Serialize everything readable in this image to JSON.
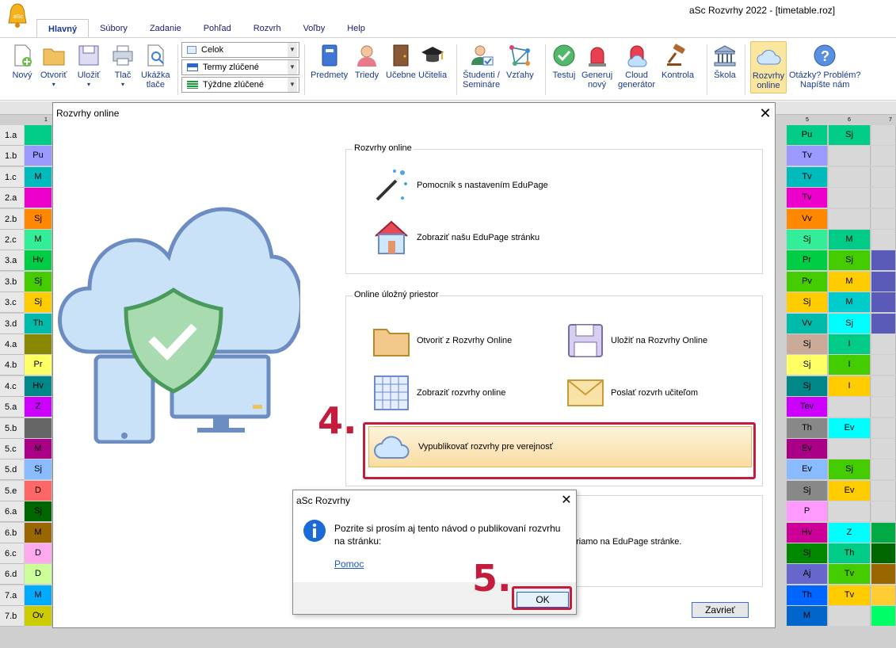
{
  "app": {
    "title": "aSc Rozvrhy 2022  - [timetable.roz]"
  },
  "tabs": [
    "Hlavný",
    "Súbory",
    "Zadanie",
    "Pohľad",
    "Rozvrh",
    "Voľby",
    "Help"
  ],
  "ribbon": {
    "novy": "Nový",
    "otvorit": "Otvoriť",
    "ulozit": "Uložiť",
    "tlac": "Tlač",
    "ukazka1": "Ukážka",
    "ukazka2": "tlače",
    "combo1": "Celok",
    "combo2": "Termy zlúčené",
    "combo3": "Týždne zlúčené",
    "predmety": "Predmety",
    "triedy": "Triedy",
    "ucebne": "Učebne",
    "ucitelia": "Učitelia",
    "studenti1": "Študenti /",
    "studenti2": "Semináre",
    "vztahy": "Vzťahy",
    "testuj": "Testuj",
    "generuj1": "Generuj",
    "generuj2": "nový",
    "cloud1": "Cloud",
    "cloud2": "generátor",
    "kontrola": "Kontrola",
    "skola": "Škola",
    "rozvrhy1": "Rozvrhy",
    "rozvrhy2": "online",
    "otazky1": "Otázky? Problém?",
    "otazky2": "Napíšte nám"
  },
  "grid": {
    "rows": [
      "1.a",
      "1.b",
      "1.c",
      "2.a",
      "2.b",
      "2.c",
      "3.a",
      "3.b",
      "3.c",
      "3.d",
      "4.a",
      "4.b",
      "4.c",
      "5.a",
      "5.b",
      "5.c",
      "5.d",
      "5.e",
      "6.a",
      "6.b",
      "6.c",
      "6.d",
      "7.a",
      "7.b"
    ],
    "left_cells": [
      "",
      "Pu",
      "M",
      "",
      "Sj",
      "M",
      "Hv",
      "Sj",
      "Sj",
      "Th",
      "",
      "Pr",
      "Hv",
      "Z",
      "",
      "M",
      "Sj",
      "D",
      "Sj",
      "M",
      "D",
      "D",
      "M",
      "Ov"
    ],
    "left_colors": [
      "#00cc88",
      "#9999ff",
      "#00bbbb",
      "#ee00cc",
      "#ff8800",
      "#33ee99",
      "#00cc44",
      "#44cc00",
      "#ffcc00",
      "#00bbaa",
      "#888800",
      "#ffff66",
      "#008888",
      "#cc00ff",
      "#666666",
      "#aa0088",
      "#88bbff",
      "#ff6666",
      "#006600",
      "#996600",
      "#ffaaee",
      "#ccff99",
      "#00aaff",
      "#cccc00"
    ],
    "col5": [
      "Pu",
      "Tv",
      "Tv",
      "Tv",
      "Vv",
      "Sj",
      "Pr",
      "Pv",
      "Sj",
      "Vv",
      "Sj",
      "Sj",
      "Sj",
      "Tev",
      "Th",
      "Ev",
      "Ev",
      "Sj",
      "P",
      "Hv",
      "Sj",
      "Aj",
      "Th",
      "M"
    ],
    "col6": [
      "Sj",
      "",
      "",
      "",
      "",
      "M",
      "Sj",
      "M",
      "M",
      "Sj",
      "I",
      "I",
      "I",
      "",
      "Ev",
      "",
      "Sj",
      "Ev",
      "",
      "Z",
      "Th",
      "Tv",
      "Tv",
      ""
    ],
    "header_5": "5",
    "header_6": "6",
    "header_7": "7",
    "header_1": "1"
  },
  "dialog": {
    "title": "Rozvrhy online",
    "group1": "Rozvrhy online",
    "wizard": "Pomocník s nastavením EduPage",
    "show_page": "Zobraziť našu EduPage stránku",
    "group2": "Online úložný priestor",
    "open_online": "Otvoriť z Rozvrhy Online",
    "save_online": "Uložiť na Rozvrhy Online",
    "show_online": "Zobraziť rozvrhy online",
    "send_teachers": "Poslať rozvrh učiteľom",
    "publish": "Vypublikovať rozvrhy pre verejnosť",
    "edupage_tail": "priamo na EduPage stránke.",
    "close": "Zavrieť"
  },
  "annotations": {
    "step4": "4.",
    "step5": "5."
  },
  "msgbox": {
    "title": "aSc Rozvrhy",
    "text1": "Pozrite si prosím aj tento návod o publikovaní rozvrhu",
    "text2": "na stránku:",
    "link": "Pomoc",
    "ok": "OK"
  },
  "colors": {
    "accent_red": "#c41c3c",
    "ribbon_text": "#1b3a8a"
  }
}
